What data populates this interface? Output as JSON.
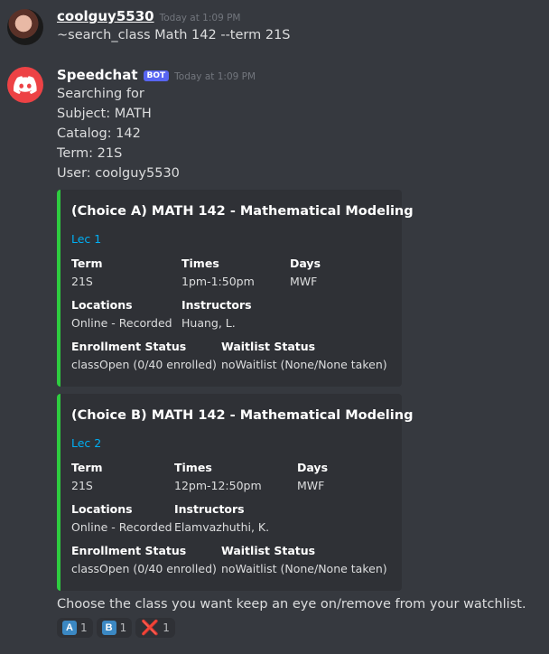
{
  "message1": {
    "author": "coolguy5530",
    "timestamp": "Today at 1:09 PM",
    "content": "~search_class Math 142 --term 21S"
  },
  "message2": {
    "author": "Speedchat",
    "bot_tag": "BOT",
    "timestamp": "Today at 1:09 PM",
    "lines": [
      "Searching for",
      "Subject: MATH",
      "Catalog: 142",
      "Term: 21S",
      "User: coolguy5530"
    ],
    "embeds": [
      {
        "title": "(Choice A) MATH 142 - Mathematical Modeling",
        "subtitle": "Lec 1",
        "term_label": "Term",
        "term": "21S",
        "times_label": "Times",
        "times": "1pm-1:50pm",
        "days_label": "Days",
        "days": "MWF",
        "locations_label": "Locations",
        "locations": "Online - Recorded",
        "instructors_label": "Instructors",
        "instructors": "Huang, L.",
        "enrollment_label": "Enrollment Status",
        "enrollment": "classOpen (0/40 enrolled)",
        "waitlist_label": "Waitlist Status",
        "waitlist": "noWaitlist (None/None taken)"
      },
      {
        "title": "(Choice B) MATH 142 - Mathematical Modeling",
        "subtitle": "Lec 2",
        "term_label": "Term",
        "term": "21S",
        "times_label": "Times",
        "times": "12pm-12:50pm",
        "days_label": "Days",
        "days": "MWF",
        "locations_label": "Locations",
        "locations": "Online - Recorded",
        "instructors_label": "Instructors",
        "instructors": "Elamvazhuthi, K.",
        "enrollment_label": "Enrollment Status",
        "enrollment": "classOpen (0/40 enrolled)",
        "waitlist_label": "Waitlist Status",
        "waitlist": "noWaitlist (None/None taken)"
      }
    ],
    "footer": "Choose the class you want keep an eye on/remove from your watchlist."
  },
  "reactions": [
    {
      "emoji": "A",
      "count": "1"
    },
    {
      "emoji": "B",
      "count": "1"
    },
    {
      "emoji": "❌",
      "count": "1"
    }
  ],
  "colors": {
    "accent": "#2ecc40",
    "link": "#00aff4",
    "bot_badge": "#5865f2",
    "discord_red": "#ed4245"
  }
}
